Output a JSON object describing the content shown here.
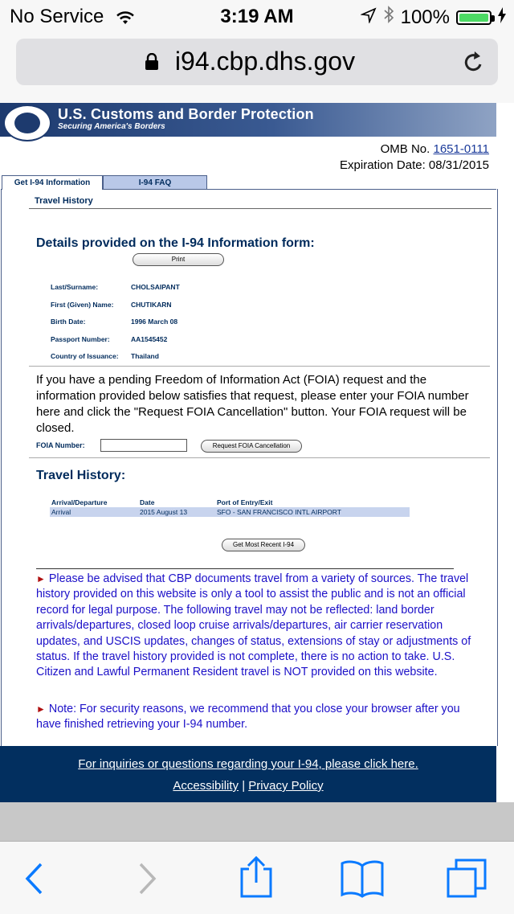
{
  "status_bar": {
    "carrier": "No Service",
    "time": "3:19 AM",
    "battery": "100%",
    "battery_level": 1.0
  },
  "browser": {
    "host": "i94.cbp.dhs.gov",
    "icons": [
      "lock-icon",
      "reload-icon",
      "back-icon",
      "forward-icon",
      "share-icon",
      "bookmarks-icon",
      "tabs-icon"
    ]
  },
  "header": {
    "title": "U.S. Customs and Border Protection",
    "subtitle": "Securing America's Borders",
    "seal_text": "DEPARTMENT OF HOMELAND SECURITY"
  },
  "omb": {
    "label": "OMB No.",
    "number": "1651-0111",
    "expiration": "Expiration Date: 08/31/2015"
  },
  "tabs": [
    {
      "label": "Get I-94 Information",
      "active": true
    },
    {
      "label": "I-94 FAQ",
      "active": false
    }
  ],
  "section_title": "Travel History",
  "details": {
    "heading": "Details provided on the I-94 Information form:",
    "print_label": "Print",
    "fields": [
      {
        "label": "Last/Surname:",
        "value": "CHOLSAIPANT"
      },
      {
        "label": "First (Given) Name:",
        "value": "CHUTIKARN"
      },
      {
        "label": "Birth Date:",
        "value": "1996 March 08"
      },
      {
        "label": "Passport Number:",
        "value": "AA1545452"
      },
      {
        "label": "Country of Issuance:",
        "value": "Thailand"
      }
    ]
  },
  "foia": {
    "text": "If you have a pending Freedom of Information Act (FOIA) request and the information provided below satisfies that request, please enter your FOIA number here and click the \"Request FOIA Cancellation\" button. Your FOIA request will be closed.",
    "label": "FOIA Number:",
    "value": "",
    "button": "Request FOIA Cancellation"
  },
  "travel_history": {
    "heading": "Travel History:",
    "columns": [
      "Arrival/Departure",
      "Date",
      "Port of Entry/Exit"
    ],
    "rows": [
      [
        "Arrival",
        "2015 August 13",
        "SFO - SAN FRANCISCO INTL AIRPORT"
      ]
    ],
    "button": "Get Most Recent I-94"
  },
  "notices": [
    "Please be advised that CBP documents travel from a variety of sources. The travel history provided on this website is only a tool to assist the public and is not an official record for legal purpose. The following travel may not be reflected: land border arrivals/departures, closed loop cruise arrivals/departures, air carrier reservation updates, and USCIS updates, changes of status, extensions of stay or adjustments of status. If the travel history provided is not complete, there is no action to take. U.S. Citizen and Lawful Permanent Resident travel is NOT provided on this website.",
    "Note: For security reasons, we recommend that you close your browser after you have finished retrieving your I-94 number."
  ],
  "footer": {
    "inquiries": "For inquiries or questions regarding your I-94, please click here.",
    "accessibility": "Accessibility",
    "separator": "|",
    "privacy": "Privacy Policy"
  },
  "colors": {
    "navy": "#002b5c",
    "footer_bg": "#022f5f",
    "notice_text": "#1c10c8",
    "ios_blue": "#0a7aff",
    "battery_green": "#4cd964"
  }
}
